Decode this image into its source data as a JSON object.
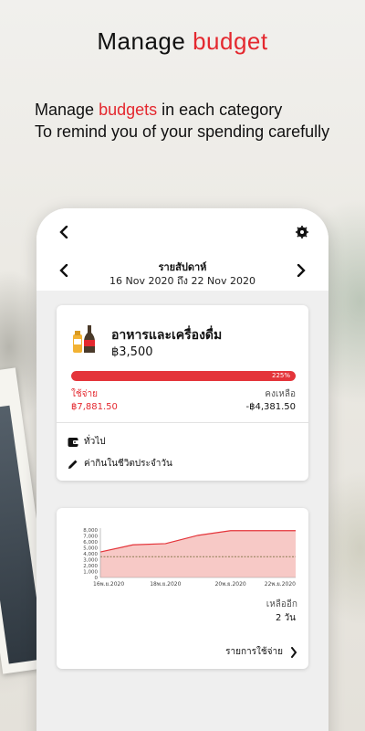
{
  "header": {
    "title_prefix": "Manage ",
    "title_accent": "budget",
    "line1_prefix": "Manage ",
    "line1_accent": "budgets",
    "line1_suffix": " in each category",
    "line2": "To remind you of your spending carefully"
  },
  "background": {
    "side_phone_status": "24"
  },
  "nav": {
    "back_icon": "chevron-left-icon",
    "settings_icon": "gear-icon"
  },
  "period": {
    "title": "รายสัปดาห์",
    "range": "16 Nov 2020 ถึง 22 Nov 2020",
    "prev_icon": "chevron-left-icon",
    "next_icon": "chevron-right-icon"
  },
  "budget_card": {
    "category": "อาหารและเครื่องดื่ม",
    "budget": "฿3,500",
    "progress_label": "225%",
    "progress_fraction": 1.0,
    "spent_label": "ใช้จ่าย",
    "spent_value": "฿7,881.50",
    "left_label": "คงเหลือ",
    "left_value": "-฿4,381.50",
    "wallet_label": "ทั่วไป",
    "note_label": "ค่ากินในชีวิตประจำวัน"
  },
  "chart_card": {
    "remain_label": "เหลืออีก",
    "remain_value": "2 วัน",
    "list_link": "รายการใช้จ่าย"
  },
  "chart_data": {
    "type": "area",
    "x_tick_labels": [
      "16พ.ย.2020",
      "18พ.ย.2020",
      "20พ.ย.2020",
      "22พ.ย.2020"
    ],
    "y_tick_labels": [
      "8,000",
      "7,000",
      "6,000",
      "5,000",
      "4,000",
      "3,000",
      "2,000",
      "1,000",
      "0"
    ],
    "ylim": [
      0,
      8000
    ],
    "x": [
      16,
      17,
      18,
      19,
      20,
      21,
      22
    ],
    "values": [
      4300,
      5500,
      5700,
      7100,
      7881.5,
      7881.5,
      7881.5
    ],
    "budget_line": 3500,
    "colors": {
      "area": "#f7c9c6",
      "line": "#e4343a",
      "budget": "#8a7a50"
    }
  },
  "colors": {
    "accent": "#e4282f",
    "progress": "#e4343a"
  }
}
